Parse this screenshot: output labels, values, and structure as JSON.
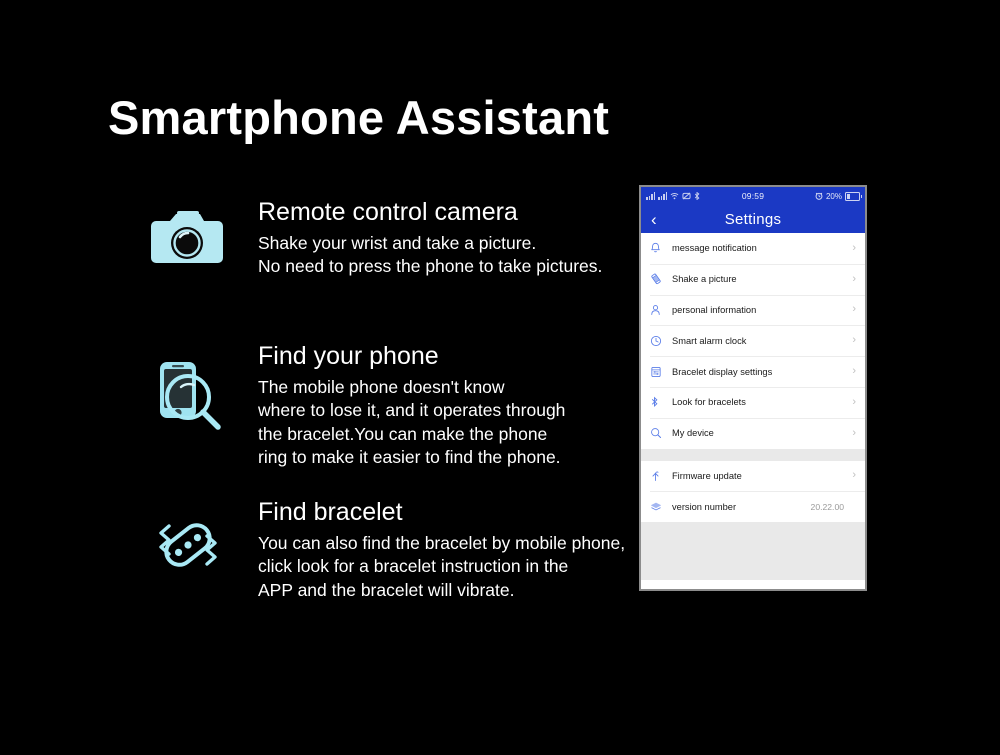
{
  "page": {
    "title": "Smartphone Assistant",
    "background_color": "#000000",
    "text_color": "#ffffff",
    "icon_color": "#b5e8f2"
  },
  "features": [
    {
      "icon": "camera-icon",
      "heading": "Remote control camera",
      "body": "Shake your wrist and take a picture.\nNo need to press the phone to take pictures."
    },
    {
      "icon": "find-phone-magnifier-icon",
      "heading": "Find your phone",
      "body": "The mobile phone doesn't know\nwhere to lose it, and it operates through\nthe bracelet.You can make the phone\nring to make it easier to find the phone."
    },
    {
      "icon": "bracelet-vibrate-icon",
      "heading": "Find bracelet",
      "body": "You can also find the bracelet by mobile phone,\n click  look for a bracelet instruction in the\nAPP and the bracelet will vibrate."
    }
  ],
  "phone": {
    "status_bar": {
      "time": "09:59",
      "battery_percent": "20%",
      "icons": [
        "signal-bars-icon",
        "signal-bars-icon",
        "wifi-icon",
        "mute-icon",
        "bluetooth-icon",
        "alarm-clock-icon",
        "battery-icon"
      ],
      "background_color": "#1b39c4"
    },
    "nav": {
      "back_icon": "chevron-left-icon",
      "title": "Settings"
    },
    "settings_groups": [
      {
        "rows": [
          {
            "icon": "bell-icon",
            "label": "message notification",
            "chevron": "›",
            "value": ""
          },
          {
            "icon": "shake-phone-icon",
            "label": "Shake a picture",
            "chevron": "›",
            "value": ""
          },
          {
            "icon": "person-icon",
            "label": "personal information",
            "chevron": "›",
            "value": ""
          },
          {
            "icon": "clock-icon",
            "label": "Smart alarm clock",
            "chevron": "›",
            "value": ""
          },
          {
            "icon": "display-settings-icon",
            "label": "Bracelet display settings",
            "chevron": "›",
            "value": ""
          },
          {
            "icon": "bluetooth-icon",
            "label": "Look for bracelets",
            "chevron": "›",
            "value": ""
          },
          {
            "icon": "search-icon",
            "label": "My device",
            "chevron": "›",
            "value": ""
          }
        ]
      },
      {
        "rows": [
          {
            "icon": "upload-arrow-icon",
            "label": "Firmware update",
            "chevron": "›",
            "value": ""
          },
          {
            "icon": "layers-icon",
            "label": "version number",
            "chevron": "",
            "value": "20.22.00"
          }
        ]
      }
    ]
  }
}
